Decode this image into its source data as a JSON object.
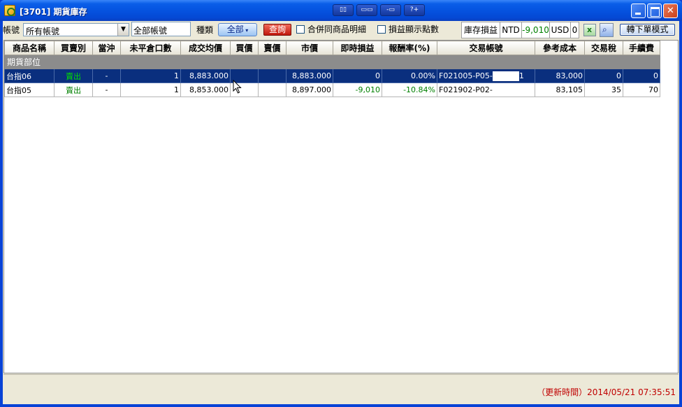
{
  "window": {
    "title": "[3701] 期貨庫存",
    "toolbar_icons": [
      "layout-icon",
      "window-icon",
      "dock-icon",
      "help-icon"
    ],
    "tool_labels": [
      "▯▯",
      "▭▭",
      "-▭",
      "?+"
    ]
  },
  "filters": {
    "account_label": "帳號",
    "account_value": "所有帳號",
    "account_name_value": "全部帳號",
    "type_label": "種類",
    "type_value": "全部",
    "query_button": "查詢",
    "merge_label": "合併同商品明細",
    "decimal_label": "損益顯示點數"
  },
  "summary": {
    "label": "庫存損益",
    "ntd_label": "NTD",
    "ntd_value": "-9,010",
    "usd_label": "USD",
    "usd_value": "0",
    "mode_button": "轉下單模式"
  },
  "table": {
    "columns": [
      "商品名稱",
      "買賣別",
      "當沖",
      "未平倉口數",
      "成交均價",
      "買價",
      "賣價",
      "市價",
      "即時損益",
      "報酬率(%)",
      "交易帳號",
      "參考成本",
      "交易稅",
      "手續費"
    ],
    "group_label": "期貨部位",
    "rows": [
      {
        "name": "台指06",
        "side": "賣出",
        "daytrade": "-",
        "open_qty": "1",
        "avg_price": "8,883.000",
        "bid": "",
        "ask": "",
        "market": "8,883.000",
        "pnl": "0",
        "return": "0.00%",
        "account_prefix": "F021005-P05-",
        "account_suffix": "1",
        "cost": "83,000",
        "tax": "0",
        "fee": "0"
      },
      {
        "name": "台指05",
        "side": "賣出",
        "daytrade": "-",
        "open_qty": "1",
        "avg_price": "8,853.000",
        "bid": "",
        "ask": "",
        "market": "8,897.000",
        "pnl": "-9,010",
        "return": "-10.84%",
        "account_prefix": "F021902-P02-",
        "account_suffix": "",
        "cost": "83,105",
        "tax": "35",
        "fee": "70"
      }
    ]
  },
  "status": {
    "update_time": "（更新時間）2014/05/21 07:35:51"
  },
  "colors": {
    "titlebar": "#0553e0",
    "selected_row": "#0a2f7e",
    "group_row": "#8c8c8c",
    "sell_text": "#008000",
    "update_text": "#c00000"
  }
}
